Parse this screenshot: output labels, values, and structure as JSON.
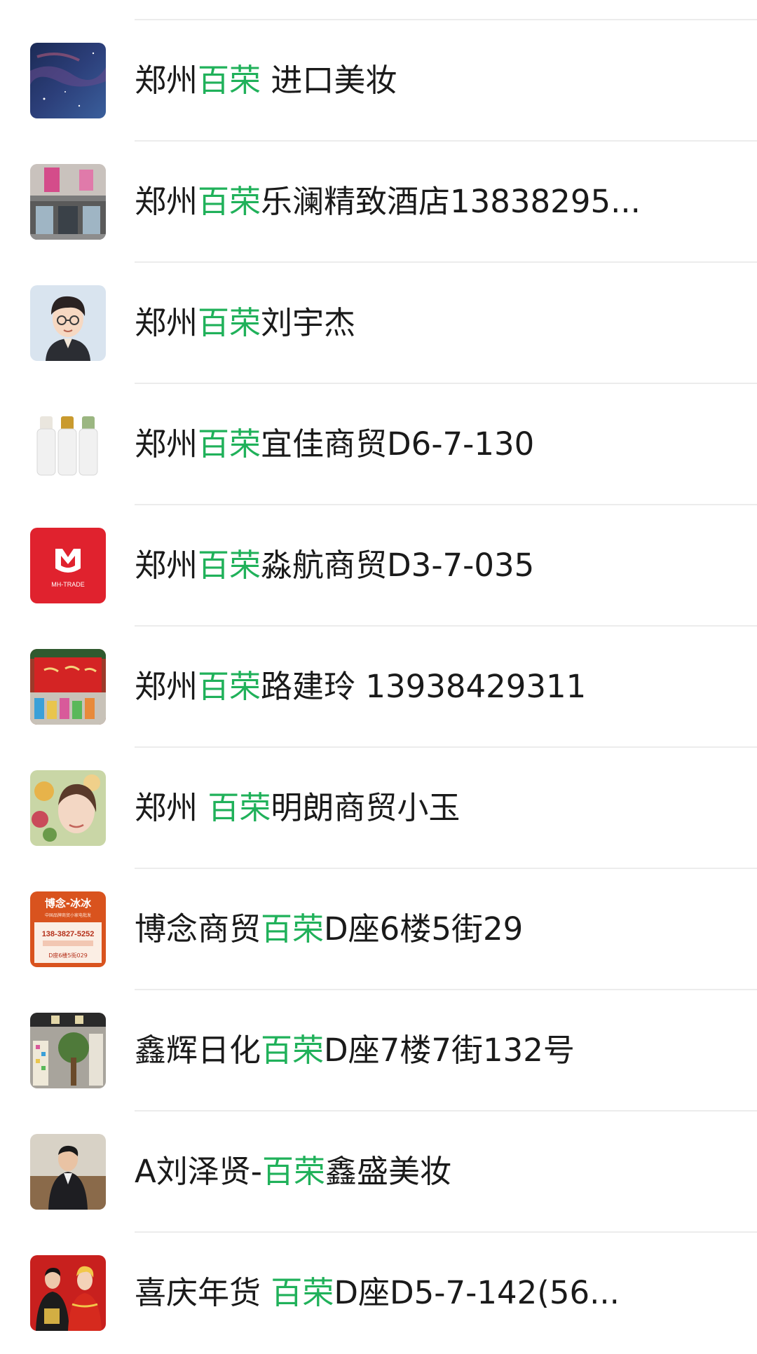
{
  "colors": {
    "highlight": "#20b15a",
    "text": "#1a1a1a",
    "divider": "#ececec"
  },
  "search_results": [
    {
      "before": "郑州",
      "highlight": "百荣",
      "after": " 进口美妆",
      "avatar": "night-sky-avatar"
    },
    {
      "before": "郑州",
      "highlight": "百荣",
      "after": "乐澜精致酒店13838295...",
      "avatar": "hotel-storefront-avatar"
    },
    {
      "before": "郑州",
      "highlight": "百荣",
      "after": "刘宇杰",
      "avatar": "cartoon-boy-avatar"
    },
    {
      "before": "郑州",
      "highlight": "百荣",
      "after": "宜佳商贸D6-7-130",
      "avatar": "spray-bottles-avatar"
    },
    {
      "before": "郑州",
      "highlight": "百荣",
      "after": "淼航商贸D3-7-035",
      "avatar": "mh-trade-logo-avatar"
    },
    {
      "before": "郑州",
      "highlight": "百荣",
      "after": "路建玲 13938429311",
      "avatar": "red-banner-shop-avatar"
    },
    {
      "before": "郑州 ",
      "highlight": "百荣",
      "after": "明朗商贸小玉",
      "avatar": "woman-flowers-avatar"
    },
    {
      "before": "博念商贸",
      "highlight": "百荣",
      "after": "D座6楼5街29",
      "avatar": "bonian-business-card-avatar"
    },
    {
      "before": "鑫辉日化",
      "highlight": "百荣",
      "after": "D座7楼7街132号",
      "avatar": "shop-display-avatar"
    },
    {
      "before": "A刘泽贤-",
      "highlight": "百荣",
      "after": "鑫盛美妆",
      "avatar": "man-in-suit-avatar"
    },
    {
      "before": "喜庆年货 ",
      "highlight": "百荣",
      "after": "D座D5-7-142(56...",
      "avatar": "wedding-couple-avatar"
    }
  ],
  "avatar_text": {
    "mh_logo": "MH-TRADE",
    "bonian_title": "博念-冰冰",
    "bonian_subtitle": "中国品牌商贸小家电批发",
    "bonian_phone": "138-3827-5252",
    "bonian_address": "D座6楼5街029"
  }
}
